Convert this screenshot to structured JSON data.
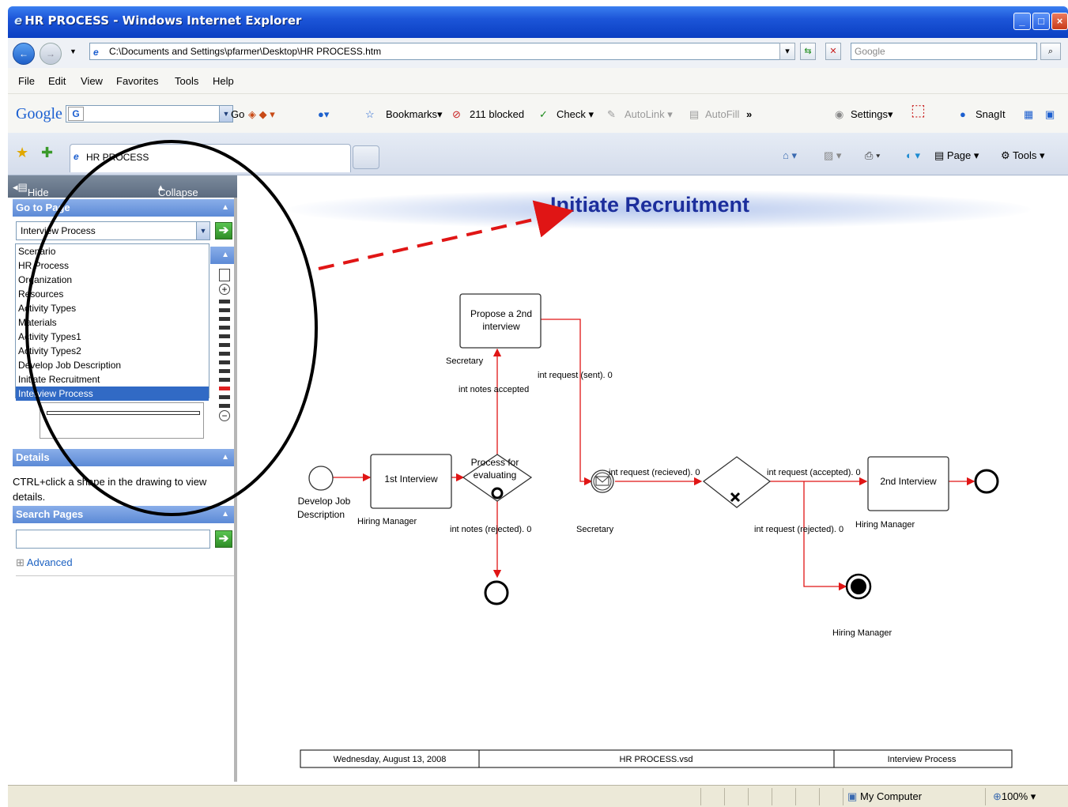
{
  "window": {
    "title": "HR PROCESS - Windows Internet Explorer"
  },
  "address": {
    "url": "C:\\Documents and Settings\\pfarmer\\Desktop\\HR PROCESS.htm",
    "search_placeholder": "Google"
  },
  "menu": [
    "File",
    "Edit",
    "View",
    "Favorites",
    "Tools",
    "Help"
  ],
  "google_toolbar": {
    "logo": "Google",
    "go": "Go",
    "bookmarks": "Bookmarks",
    "blocked": "211 blocked",
    "check": "Check",
    "autolink": "AutoLink",
    "autofill": "AutoFill",
    "more": "»",
    "settings": "Settings",
    "snagit": "SnagIt"
  },
  "tabs": {
    "active": "HR PROCESS"
  },
  "command_bar": {
    "page": "Page",
    "tools": "Tools"
  },
  "left_pane": {
    "hide": "Hide",
    "collapse_all": "Collapse all",
    "go_to_page": "Go to Page",
    "selected_page": "Interview Process",
    "pages": [
      "Scenario",
      "HR Process",
      "Organization",
      "Resources",
      "Activity Types",
      "Materials",
      "Activity Types1",
      "Activity Types2",
      "Develop Job Description",
      "Initiate Recruitment",
      "Interview Process"
    ],
    "details": "Details",
    "details_text": "CTRL+click a shape in the drawing to view details.",
    "search_pages": "Search Pages",
    "advanced": "Advanced"
  },
  "drawing": {
    "title": "Initiate Recruitment",
    "shapes": {
      "propose": "Propose a 2nd interview",
      "first_interview": "1st Interview",
      "second_interview": "2nd Interview",
      "process_for_evaluating": "Process for evaluating"
    },
    "labels": {
      "develop_job_description": "Develop Job Description",
      "hiring_manager_1": "Hiring Manager",
      "secretary_top": "Secretary",
      "int_notes_accepted": "int notes accepted",
      "int_request_sent": "int request (sent).  0",
      "int_notes_rejected": "int notes (rejected).  0",
      "secretary_bottom": "Secretary",
      "int_request_recieved": "int request (recieved).  0",
      "int_request_accepted": "int request (accepted).  0",
      "int_request_rejected": "int request (rejected).  0",
      "hiring_manager_2": "Hiring Manager",
      "hiring_manager_3": "Hiring Manager"
    },
    "footer": {
      "date": "Wednesday, August 13, 2008",
      "file": "HR PROCESS.vsd",
      "page": "Interview Process"
    }
  },
  "status": {
    "zone": "My Computer",
    "zoom": "100%"
  },
  "colors": {
    "flow": "#e01515",
    "title": "#1c2e9c",
    "selection": "#316ac5"
  }
}
